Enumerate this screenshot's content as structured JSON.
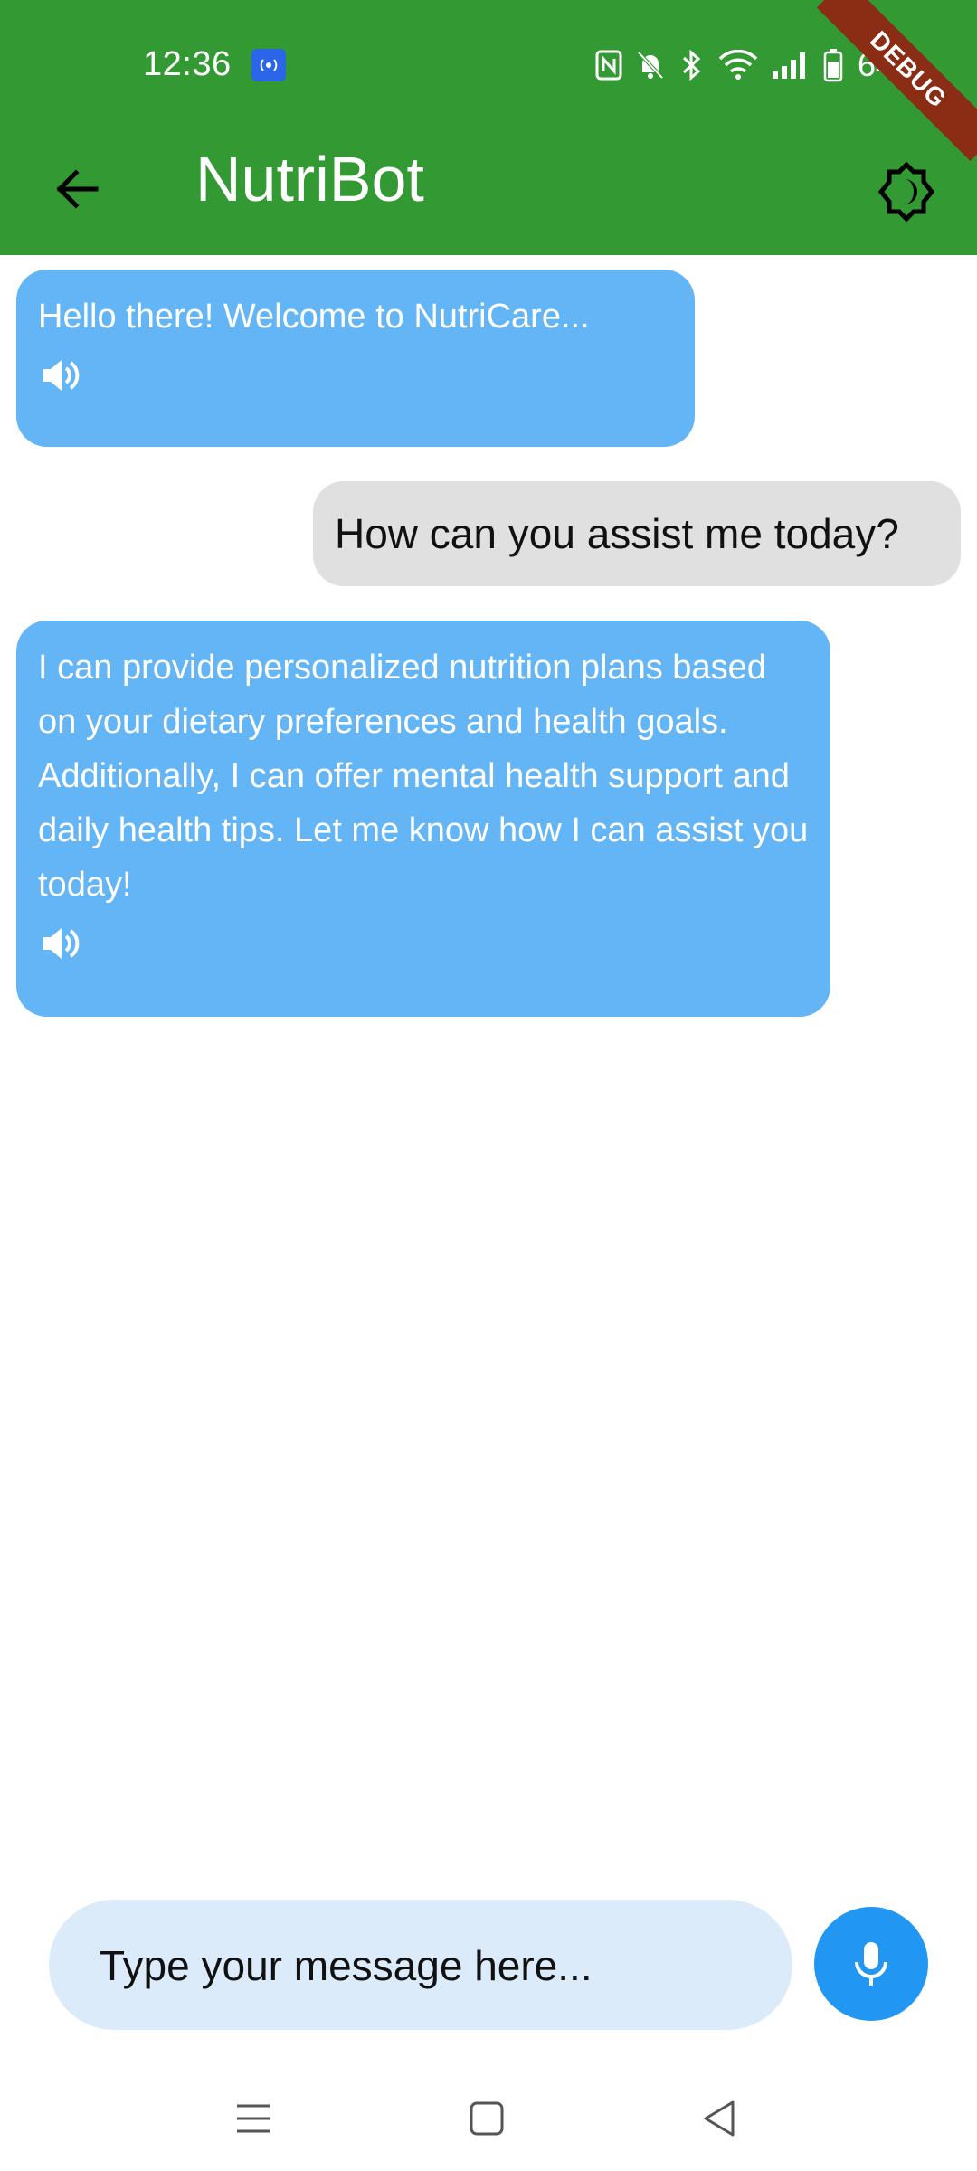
{
  "status_bar": {
    "time": "12:36",
    "battery_percent": "64%",
    "icons": [
      "hotspot-icon",
      "nfc-icon",
      "bell-muted-icon",
      "bluetooth-icon",
      "wifi-icon",
      "signal-icon",
      "battery-icon"
    ]
  },
  "debug_banner": "DEBUG",
  "app_bar": {
    "title": "NutriBot",
    "back_icon": "arrow-left-icon",
    "theme_icon": "brightness-icon",
    "background_color": "#339933"
  },
  "messages": [
    {
      "sender": "bot",
      "text": "Hello there! Welcome to NutriCare...",
      "speak_icon": "volume-icon"
    },
    {
      "sender": "user",
      "text": "How can you assist me today?"
    },
    {
      "sender": "bot",
      "text": "I can provide personalized nutrition plans based on your dietary preferences and health goals. Additionally, I can offer mental health support and daily health tips. Let me know how I can assist you today!",
      "speak_icon": "volume-icon"
    }
  ],
  "composer": {
    "placeholder": "Type your message here...",
    "value": "",
    "mic_icon": "mic-icon"
  },
  "nav_bar": {
    "icons": [
      "menu-icon",
      "home-square-icon",
      "back-triangle-icon"
    ]
  },
  "colors": {
    "bot_bubble": "#64b5f6",
    "user_bubble": "#e0e0e0",
    "mic_button": "#2196f3",
    "composer_bg": "#dcebfa"
  }
}
